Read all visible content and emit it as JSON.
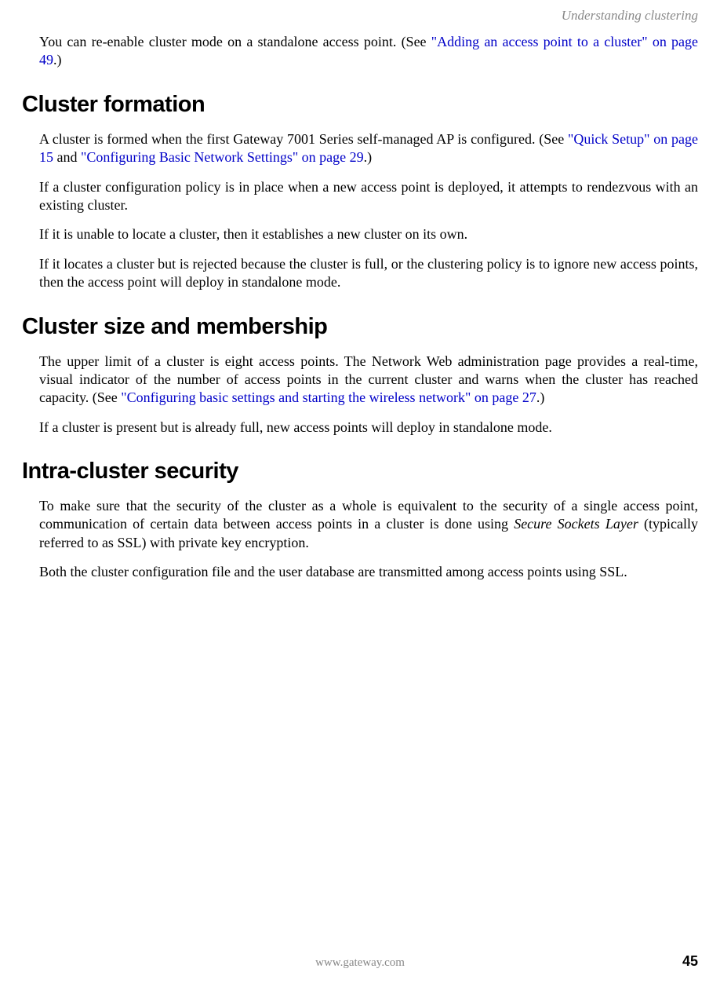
{
  "header": {
    "running_title": "Understanding clustering"
  },
  "intro": {
    "p1_pre": "You can re-enable cluster mode on a standalone access point. (See ",
    "p1_link": "\"Adding an access point to a cluster\" on page 49",
    "p1_post": ".)"
  },
  "sections": {
    "formation": {
      "title": "Cluster formation",
      "p1_pre": "A cluster is formed when the first Gateway 7001 Series self-managed AP is configured. (See ",
      "p1_link1": "\"Quick Setup\" on page 15",
      "p1_mid": " and ",
      "p1_link2": "\"Configuring Basic Network Settings\" on page 29",
      "p1_post": ".)",
      "p2": "If a cluster configuration policy is in place when a new access point is deployed, it attempts to rendezvous with an existing cluster.",
      "p3": "If it is unable to locate a cluster, then it establishes a new cluster on its own.",
      "p4": "If it locates a cluster but is rejected because the cluster is full, or the clustering policy is to ignore new access points, then the access point will deploy in standalone mode."
    },
    "size": {
      "title": "Cluster size and membership",
      "p1_pre": "The upper limit of a cluster is eight access points. The Network Web administration page provides a real-time, visual indicator of the number of access points in the current cluster and warns when the cluster has reached capacity. (See ",
      "p1_link": "\"Configuring basic settings and starting the wireless network\" on page 27",
      "p1_post": ".)",
      "p2": "If a cluster is present but is already full, new access points will deploy in standalone mode."
    },
    "security": {
      "title": "Intra-cluster security",
      "p1_pre": "To make sure that the security of the cluster as a whole is equivalent to the security of a single access point, communication of certain data between access points in a cluster is done using ",
      "p1_italic": "Secure Sockets Layer",
      "p1_post": " (typically referred to as SSL) with private key encryption.",
      "p2": "Both the cluster configuration file and the user database are transmitted among access points using SSL."
    }
  },
  "footer": {
    "url": "www.gateway.com",
    "page_number": "45"
  }
}
